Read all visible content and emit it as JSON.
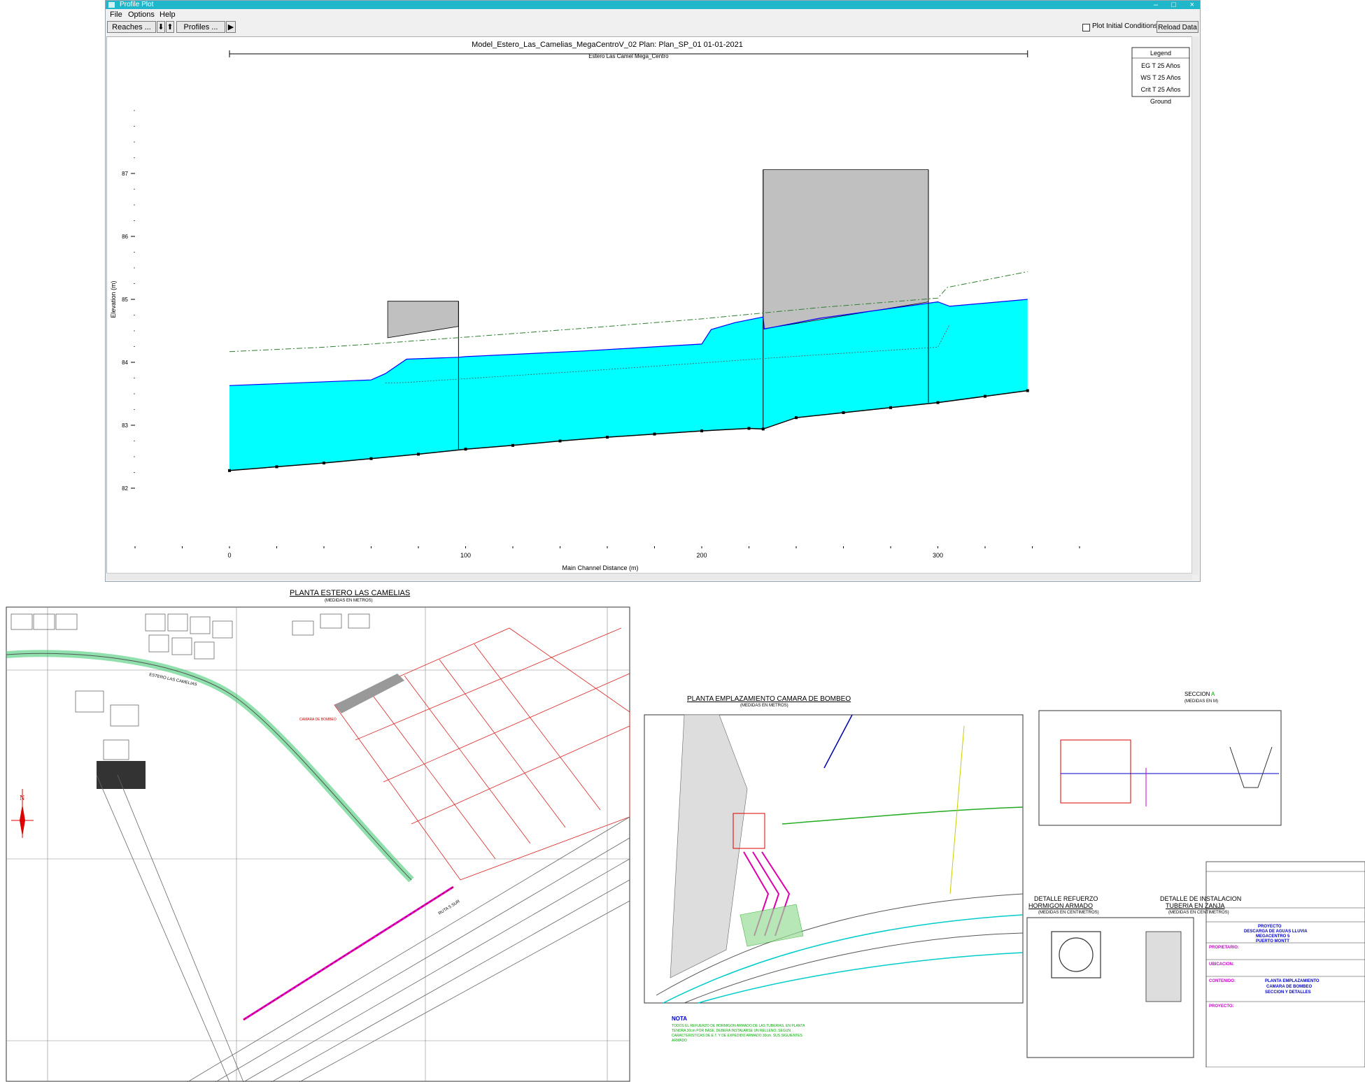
{
  "window": {
    "title": "Profile Plot",
    "menu": [
      "File",
      "Options",
      "Help"
    ],
    "toolbar": {
      "reaches_button": "Reaches ...",
      "down_arrow": "⬇",
      "up_arrow": "⬆",
      "profiles_button": "Profiles ...",
      "play_button": "▶",
      "initial_conditions_label": "Plot Initial Conditions",
      "reload_button": "Reload Data"
    }
  },
  "chart_data": {
    "type": "area",
    "title": "Model_Estero_Las_Camelias_MegaCentroV_02      Plan: Plan_SP_01    01-01-2021",
    "subtitle": "Estero Las Camel Mega_Centro",
    "xlabel": "Main Channel Distance (m)",
    "ylabel": "Elevation (m)",
    "xlim": [
      -40,
      360
    ],
    "ylim": [
      81.5,
      88.5
    ],
    "x_ticks": [
      0,
      100,
      200,
      300
    ],
    "y_ticks": [
      82,
      83,
      84,
      85,
      86,
      87
    ],
    "y_tick_labels": [
      "82",
      "83",
      "84",
      "85",
      "86",
      "87"
    ],
    "legend": {
      "title": "Legend",
      "placement": "top-right",
      "entries": [
        "EG T 25 Años",
        "WS T 25 Años",
        "Crit T 25 Años",
        "Ground"
      ]
    },
    "series": [
      {
        "name": "Ground",
        "color": "#000000",
        "x": [
          0,
          20,
          40,
          60,
          80,
          100,
          120,
          140,
          160,
          180,
          200,
          220,
          226,
          240,
          260,
          280,
          300,
          320,
          338
        ],
        "y": [
          82.28,
          82.34,
          82.4,
          82.47,
          82.54,
          82.62,
          82.68,
          82.75,
          82.81,
          82.86,
          82.91,
          82.95,
          82.94,
          83.12,
          83.2,
          83.28,
          83.36,
          83.46,
          83.55
        ]
      },
      {
        "name": "WS T 25 Años",
        "color": "#0000ff",
        "x": [
          0,
          60,
          66,
          75,
          97,
          100,
          150,
          200,
          204,
          214,
          226,
          226.5,
          250,
          300,
          305,
          338
        ],
        "y": [
          83.63,
          83.72,
          83.82,
          84.05,
          84.08,
          84.09,
          84.18,
          84.29,
          84.52,
          84.63,
          84.72,
          84.53,
          84.7,
          84.96,
          84.89,
          85.0
        ]
      },
      {
        "name": "EG T 25 Años",
        "color": "#2e7d2e",
        "x": [
          0,
          40,
          60,
          100,
          150,
          200,
          250,
          300,
          304,
          338
        ],
        "y": [
          84.17,
          84.24,
          84.29,
          84.4,
          84.54,
          84.69,
          84.87,
          85.02,
          85.19,
          85.44
        ]
      },
      {
        "name": "Crit T 25 Años",
        "color": "#555555",
        "x": [
          66,
          75,
          100,
          150,
          200,
          226,
          250,
          300,
          305
        ],
        "y": [
          83.67,
          83.68,
          83.74,
          83.86,
          83.99,
          84.06,
          84.12,
          84.24,
          84.6
        ]
      }
    ],
    "bridges": [
      {
        "x0": 67,
        "x1": 97,
        "top": 84.97,
        "bottom_left": 84.39,
        "bottom_right": 84.57
      },
      {
        "x0": 226,
        "x1": 296,
        "top": 87.06,
        "bottom_left": 84.53,
        "bottom_right": 84.96
      }
    ]
  },
  "drawing_left": {
    "title": "PLANTA ESTERO LAS CAMELIAS",
    "subtitle": "(MEDIDAS EN METROS)",
    "labels": [
      "ESTERO LAS CAMELIAS",
      "CAMARA DE BOMBEO",
      "RUTA 5 SUR"
    ]
  },
  "drawing_right": {
    "plan_title": "PLANTA EMPLAZAMIENTO  CAMARA DE BOMBEO",
    "plan_sub": "(MEDIDAS EN METROS)",
    "section_title": "SECCION",
    "section_marker": "A",
    "section_sub": "(MEDIDAS EN M)",
    "detail1_title_a": "DETALLE REFUERZO",
    "detail1_title_b": "HORMIGON  ARMADO",
    "detail1_sub": "(MEDIDAS EN CENTIMETROS)",
    "detail2_title_a": "DETALLE DE INSTALACION",
    "detail2_title_b": "TUBERIA  EN  ZANJA",
    "detail2_sub": "(MEDIDAS EN CENTIMETROS)",
    "note_title": "NOTA",
    "note_text": "TODOS EL REFUERZO DE HORMIGON ARMADO DE LAS TUBERIAS, EN PLANTA TENDRA 30cm POR BASE. DEBERA INSTALARSE UN RELLENO, SEGUN CARACTERISTICAS DE E.T. Y DE EXPEDIDO ARMADO 30cm. SUS SIGUIENTES ARMADO",
    "project_label": "PROYECTO",
    "project_name_a": "DESCARGA DE AGUAS LLUVIA",
    "project_name_b": "MEGACENTRO 5",
    "project_name_c": "PUERTO MONTT",
    "owner_label": "PROPIETARIO:",
    "location_label": "UBICACION:",
    "content_label": "CONTENIDO:",
    "content_a": "PLANTA EMPLAZAMIENTO",
    "content_b": "CAMARA DE BOMBEO",
    "content_c": "SECCION Y DETALLES",
    "project_row_label": "PROYECTO:"
  }
}
